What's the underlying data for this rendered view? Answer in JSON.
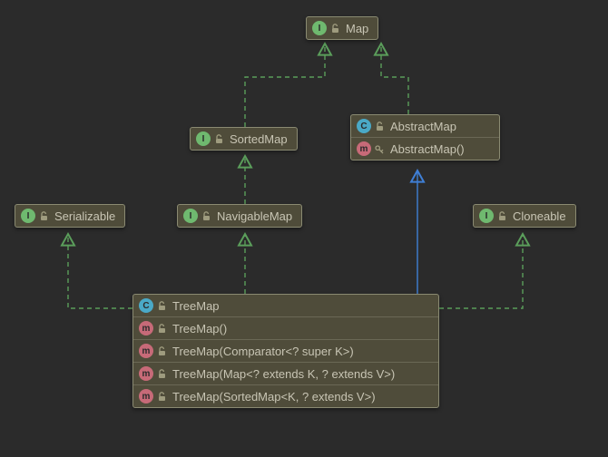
{
  "diagram": {
    "nodes": {
      "map": {
        "title": "Map",
        "kind": "interface"
      },
      "sortedMap": {
        "title": "SortedMap",
        "kind": "interface"
      },
      "navigableMap": {
        "title": "NavigableMap",
        "kind": "interface"
      },
      "serializable": {
        "title": "Serializable",
        "kind": "interface"
      },
      "cloneable": {
        "title": "Cloneable",
        "kind": "interface"
      },
      "abstractMap": {
        "title": "AbstractMap",
        "kind": "abstract-class",
        "members": [
          {
            "kind": "constructor",
            "visibility": "protected",
            "label": "AbstractMap()"
          }
        ]
      },
      "treeMap": {
        "title": "TreeMap",
        "kind": "class",
        "members": [
          {
            "kind": "constructor",
            "visibility": "public",
            "label": "TreeMap()"
          },
          {
            "kind": "constructor",
            "visibility": "public",
            "label": "TreeMap(Comparator<? super K>)"
          },
          {
            "kind": "constructor",
            "visibility": "public",
            "label": "TreeMap(Map<? extends K, ? extends V>)"
          },
          {
            "kind": "constructor",
            "visibility": "public",
            "label": "TreeMap(SortedMap<K, ? extends V>)"
          }
        ]
      }
    },
    "edges": [
      {
        "from": "sortedMap",
        "to": "map",
        "style": "implements"
      },
      {
        "from": "abstractMap",
        "to": "map",
        "style": "implements"
      },
      {
        "from": "navigableMap",
        "to": "sortedMap",
        "style": "implements"
      },
      {
        "from": "treeMap",
        "to": "serializable",
        "style": "implements"
      },
      {
        "from": "treeMap",
        "to": "navigableMap",
        "style": "implements"
      },
      {
        "from": "treeMap",
        "to": "cloneable",
        "style": "implements"
      },
      {
        "from": "treeMap",
        "to": "abstractMap",
        "style": "extends"
      }
    ],
    "badges": {
      "interface": "I",
      "class": "C",
      "abstract-class": "C",
      "constructor": "m"
    }
  }
}
